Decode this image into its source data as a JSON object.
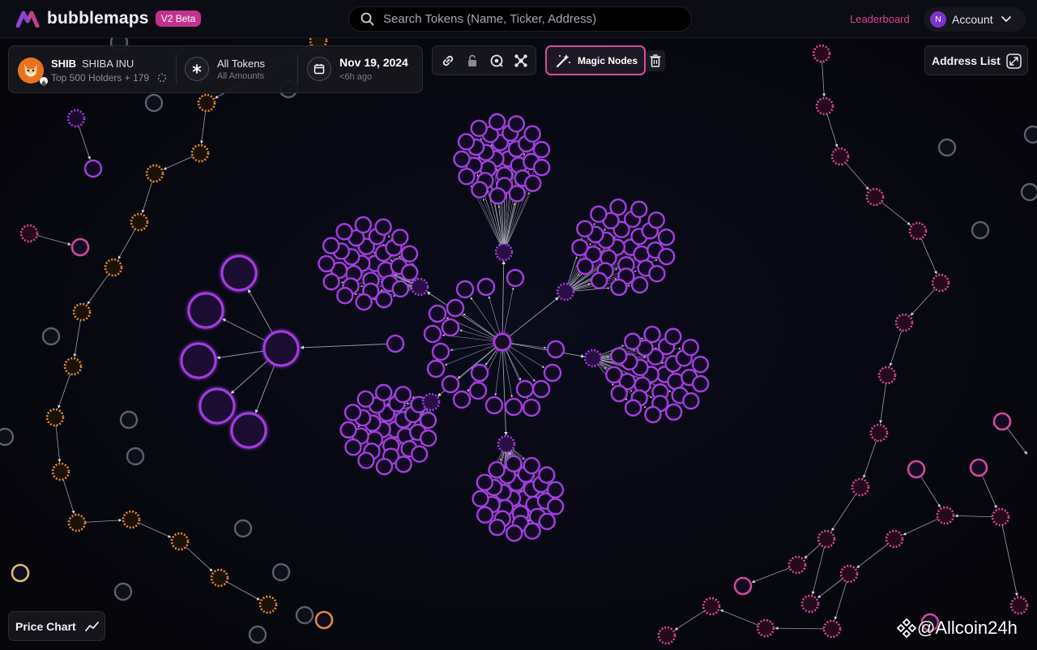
{
  "app": {
    "name": "bubblemaps",
    "badge": "V2 Beta",
    "search_placeholder": "Search Tokens (Name, Ticker, Address)",
    "leaderboard": "Leaderboard",
    "account_initial": "N",
    "account_label": "Account"
  },
  "token": {
    "ticker": "SHIB",
    "name": "SHIBA INU",
    "holders": "Top 500 Holders + 179",
    "tokens_label": "All Tokens",
    "amounts_label": "All Amounts",
    "date": "Nov 19, 2024",
    "date_ago": "<6h ago"
  },
  "toolbar": {
    "tools": [
      "link-icon",
      "lock-icon",
      "focus-icon",
      "cluster-icon"
    ],
    "magic_label": "Magic Nodes"
  },
  "address_list": "Address List",
  "price_chart": "Price Chart",
  "watermark": "@Allcoin24h",
  "colors": {
    "accent_pink": "#c1338f",
    "purple_node": "#a23ee0",
    "orange_node": "#e08a3a",
    "pink_node": "#d04a9a",
    "gray_node": "#5a6070"
  }
}
